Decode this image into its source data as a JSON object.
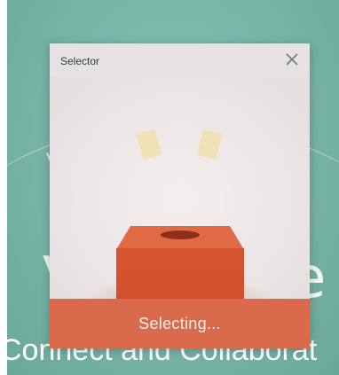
{
  "background": {
    "small_text": "V",
    "letter_left": "V",
    "letter_right": "e",
    "bottom_text": "Connect and Collaborat",
    "color": "#7bb8aa"
  },
  "dialog": {
    "title": "Selector",
    "close_icon": "close-icon",
    "status_text": "Selecting...",
    "footer_color": "#da6a4c",
    "box_color": "#d9552f"
  }
}
